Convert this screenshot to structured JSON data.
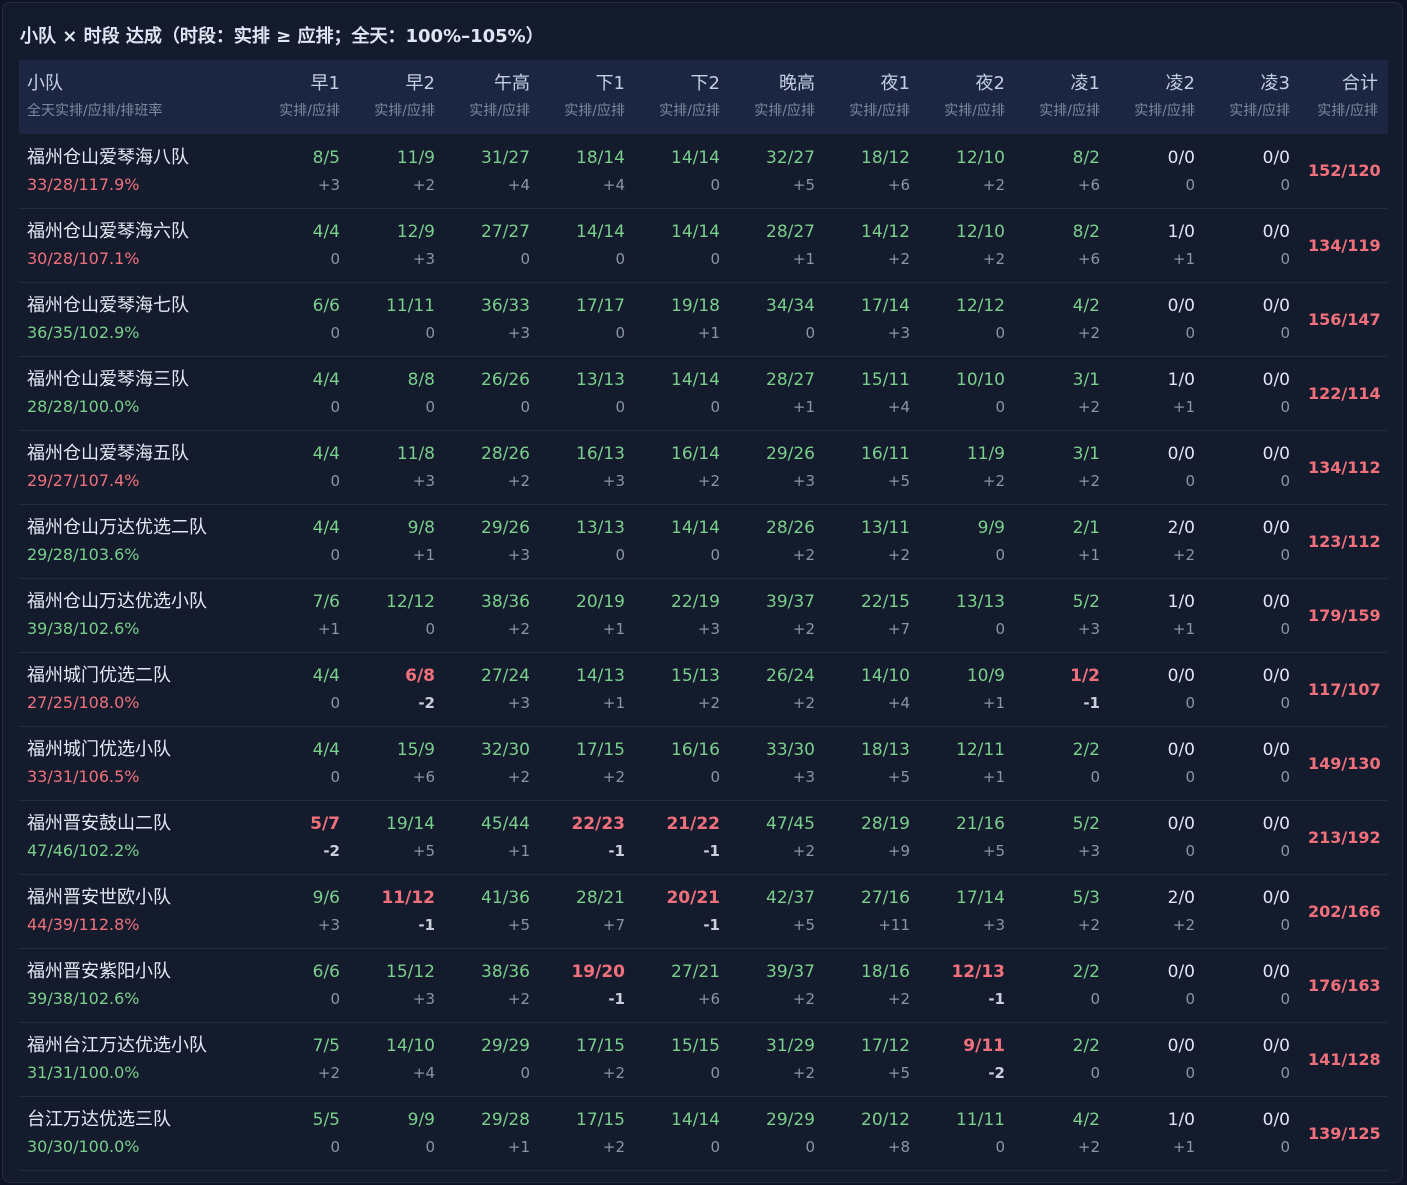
{
  "title": "小队 × 时段 达成（时段：实排 ≥ 应排；全天：100%–105%）",
  "colors": {
    "ok": "#79cf8c",
    "bad": "#f0707c",
    "neutral": "#dfe6f3",
    "muted": "#8b94a8",
    "header_bg": "#1c2642",
    "panel_bg": "#141b2c"
  },
  "header": {
    "team": "小队",
    "team_sub": "全天实排/应排/排班率",
    "slots": [
      "早1",
      "早2",
      "午高",
      "下1",
      "下2",
      "晚高",
      "夜1",
      "夜2",
      "凌1",
      "凌2",
      "凌3"
    ],
    "slot_sub": "实排/应排",
    "total": "合计",
    "total_sub": "实排/应排"
  },
  "rows": [
    {
      "name": "福州仓山爱琴海八队",
      "rate": "33/28/117.9%",
      "rate_status": "bad",
      "total": "152/120",
      "cells": [
        [
          "8/5",
          "+3"
        ],
        [
          "11/9",
          "+2"
        ],
        [
          "31/27",
          "+4"
        ],
        [
          "18/14",
          "+4"
        ],
        [
          "14/14",
          "0"
        ],
        [
          "32/27",
          "+5"
        ],
        [
          "18/12",
          "+6"
        ],
        [
          "12/10",
          "+2"
        ],
        [
          "8/2",
          "+6"
        ],
        [
          "0/0",
          "0"
        ],
        [
          "0/0",
          "0"
        ]
      ]
    },
    {
      "name": "福州仓山爱琴海六队",
      "rate": "30/28/107.1%",
      "rate_status": "bad",
      "total": "134/119",
      "cells": [
        [
          "4/4",
          "0"
        ],
        [
          "12/9",
          "+3"
        ],
        [
          "27/27",
          "0"
        ],
        [
          "14/14",
          "0"
        ],
        [
          "14/14",
          "0"
        ],
        [
          "28/27",
          "+1"
        ],
        [
          "14/12",
          "+2"
        ],
        [
          "12/10",
          "+2"
        ],
        [
          "8/2",
          "+6"
        ],
        [
          "1/0",
          "+1"
        ],
        [
          "0/0",
          "0"
        ]
      ]
    },
    {
      "name": "福州仓山爱琴海七队",
      "rate": "36/35/102.9%",
      "rate_status": "ok",
      "total": "156/147",
      "cells": [
        [
          "6/6",
          "0"
        ],
        [
          "11/11",
          "0"
        ],
        [
          "36/33",
          "+3"
        ],
        [
          "17/17",
          "0"
        ],
        [
          "19/18",
          "+1"
        ],
        [
          "34/34",
          "0"
        ],
        [
          "17/14",
          "+3"
        ],
        [
          "12/12",
          "0"
        ],
        [
          "4/2",
          "+2"
        ],
        [
          "0/0",
          "0"
        ],
        [
          "0/0",
          "0"
        ]
      ]
    },
    {
      "name": "福州仓山爱琴海三队",
      "rate": "28/28/100.0%",
      "rate_status": "ok",
      "total": "122/114",
      "cells": [
        [
          "4/4",
          "0"
        ],
        [
          "8/8",
          "0"
        ],
        [
          "26/26",
          "0"
        ],
        [
          "13/13",
          "0"
        ],
        [
          "14/14",
          "0"
        ],
        [
          "28/27",
          "+1"
        ],
        [
          "15/11",
          "+4"
        ],
        [
          "10/10",
          "0"
        ],
        [
          "3/1",
          "+2"
        ],
        [
          "1/0",
          "+1"
        ],
        [
          "0/0",
          "0"
        ]
      ]
    },
    {
      "name": "福州仓山爱琴海五队",
      "rate": "29/27/107.4%",
      "rate_status": "bad",
      "total": "134/112",
      "cells": [
        [
          "4/4",
          "0"
        ],
        [
          "11/8",
          "+3"
        ],
        [
          "28/26",
          "+2"
        ],
        [
          "16/13",
          "+3"
        ],
        [
          "16/14",
          "+2"
        ],
        [
          "29/26",
          "+3"
        ],
        [
          "16/11",
          "+5"
        ],
        [
          "11/9",
          "+2"
        ],
        [
          "3/1",
          "+2"
        ],
        [
          "0/0",
          "0"
        ],
        [
          "0/0",
          "0"
        ]
      ]
    },
    {
      "name": "福州仓山万达优选二队",
      "rate": "29/28/103.6%",
      "rate_status": "ok",
      "total": "123/112",
      "cells": [
        [
          "4/4",
          "0"
        ],
        [
          "9/8",
          "+1"
        ],
        [
          "29/26",
          "+3"
        ],
        [
          "13/13",
          "0"
        ],
        [
          "14/14",
          "0"
        ],
        [
          "28/26",
          "+2"
        ],
        [
          "13/11",
          "+2"
        ],
        [
          "9/9",
          "0"
        ],
        [
          "2/1",
          "+1"
        ],
        [
          "2/0",
          "+2"
        ],
        [
          "0/0",
          "0"
        ]
      ]
    },
    {
      "name": "福州仓山万达优选小队",
      "rate": "39/38/102.6%",
      "rate_status": "ok",
      "total": "179/159",
      "cells": [
        [
          "7/6",
          "+1"
        ],
        [
          "12/12",
          "0"
        ],
        [
          "38/36",
          "+2"
        ],
        [
          "20/19",
          "+1"
        ],
        [
          "22/19",
          "+3"
        ],
        [
          "39/37",
          "+2"
        ],
        [
          "22/15",
          "+7"
        ],
        [
          "13/13",
          "0"
        ],
        [
          "5/2",
          "+3"
        ],
        [
          "1/0",
          "+1"
        ],
        [
          "0/0",
          "0"
        ]
      ]
    },
    {
      "name": "福州城门优选二队",
      "rate": "27/25/108.0%",
      "rate_status": "bad",
      "total": "117/107",
      "cells": [
        [
          "4/4",
          "0"
        ],
        [
          "6/8",
          "-2"
        ],
        [
          "27/24",
          "+3"
        ],
        [
          "14/13",
          "+1"
        ],
        [
          "15/13",
          "+2"
        ],
        [
          "26/24",
          "+2"
        ],
        [
          "14/10",
          "+4"
        ],
        [
          "10/9",
          "+1"
        ],
        [
          "1/2",
          "-1"
        ],
        [
          "0/0",
          "0"
        ],
        [
          "0/0",
          "0"
        ]
      ]
    },
    {
      "name": "福州城门优选小队",
      "rate": "33/31/106.5%",
      "rate_status": "bad",
      "total": "149/130",
      "cells": [
        [
          "4/4",
          "0"
        ],
        [
          "15/9",
          "+6"
        ],
        [
          "32/30",
          "+2"
        ],
        [
          "17/15",
          "+2"
        ],
        [
          "16/16",
          "0"
        ],
        [
          "33/30",
          "+3"
        ],
        [
          "18/13",
          "+5"
        ],
        [
          "12/11",
          "+1"
        ],
        [
          "2/2",
          "0"
        ],
        [
          "0/0",
          "0"
        ],
        [
          "0/0",
          "0"
        ]
      ]
    },
    {
      "name": "福州晋安鼓山二队",
      "rate": "47/46/102.2%",
      "rate_status": "ok",
      "total": "213/192",
      "cells": [
        [
          "5/7",
          "-2"
        ],
        [
          "19/14",
          "+5"
        ],
        [
          "45/44",
          "+1"
        ],
        [
          "22/23",
          "-1"
        ],
        [
          "21/22",
          "-1"
        ],
        [
          "47/45",
          "+2"
        ],
        [
          "28/19",
          "+9"
        ],
        [
          "21/16",
          "+5"
        ],
        [
          "5/2",
          "+3"
        ],
        [
          "0/0",
          "0"
        ],
        [
          "0/0",
          "0"
        ]
      ]
    },
    {
      "name": "福州晋安世欧小队",
      "rate": "44/39/112.8%",
      "rate_status": "bad",
      "total": "202/166",
      "cells": [
        [
          "9/6",
          "+3"
        ],
        [
          "11/12",
          "-1"
        ],
        [
          "41/36",
          "+5"
        ],
        [
          "28/21",
          "+7"
        ],
        [
          "20/21",
          "-1"
        ],
        [
          "42/37",
          "+5"
        ],
        [
          "27/16",
          "+11"
        ],
        [
          "17/14",
          "+3"
        ],
        [
          "5/3",
          "+2"
        ],
        [
          "2/0",
          "+2"
        ],
        [
          "0/0",
          "0"
        ]
      ]
    },
    {
      "name": "福州晋安紫阳小队",
      "rate": "39/38/102.6%",
      "rate_status": "ok",
      "total": "176/163",
      "cells": [
        [
          "6/6",
          "0"
        ],
        [
          "15/12",
          "+3"
        ],
        [
          "38/36",
          "+2"
        ],
        [
          "19/20",
          "-1"
        ],
        [
          "27/21",
          "+6"
        ],
        [
          "39/37",
          "+2"
        ],
        [
          "18/16",
          "+2"
        ],
        [
          "12/13",
          "-1"
        ],
        [
          "2/2",
          "0"
        ],
        [
          "0/0",
          "0"
        ],
        [
          "0/0",
          "0"
        ]
      ]
    },
    {
      "name": "福州台江万达优选小队",
      "rate": "31/31/100.0%",
      "rate_status": "ok",
      "total": "141/128",
      "cells": [
        [
          "7/5",
          "+2"
        ],
        [
          "14/10",
          "+4"
        ],
        [
          "29/29",
          "0"
        ],
        [
          "17/15",
          "+2"
        ],
        [
          "15/15",
          "0"
        ],
        [
          "31/29",
          "+2"
        ],
        [
          "17/12",
          "+5"
        ],
        [
          "9/11",
          "-2"
        ],
        [
          "2/2",
          "0"
        ],
        [
          "0/0",
          "0"
        ],
        [
          "0/0",
          "0"
        ]
      ]
    },
    {
      "name": "台江万达优选三队",
      "rate": "30/30/100.0%",
      "rate_status": "ok",
      "total": "139/125",
      "cells": [
        [
          "5/5",
          "0"
        ],
        [
          "9/9",
          "0"
        ],
        [
          "29/28",
          "+1"
        ],
        [
          "17/15",
          "+2"
        ],
        [
          "14/14",
          "0"
        ],
        [
          "29/29",
          "0"
        ],
        [
          "20/12",
          "+8"
        ],
        [
          "11/11",
          "0"
        ],
        [
          "4/2",
          "+2"
        ],
        [
          "1/0",
          "+1"
        ],
        [
          "0/0",
          "0"
        ]
      ]
    }
  ]
}
